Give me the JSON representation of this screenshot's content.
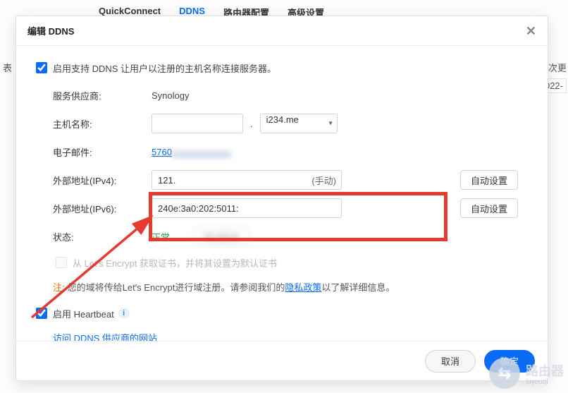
{
  "background": {
    "tabs": [
      "QuickConnect",
      "DDNS",
      "路由器配置",
      "高级设置"
    ],
    "active_tab_index": 1,
    "left_snip": "表",
    "right_snip_top": "次更",
    "right_snip_year": "022-"
  },
  "modal": {
    "title": "编辑 DDNS",
    "close_glyph": "✕"
  },
  "form": {
    "enable_checkbox_label": "启用支持 DDNS 让用户以注册的主机名称连接服务器。",
    "enable_checked": true,
    "provider_label": "服务供应商:",
    "provider_value": "Synology",
    "hostname_label": "主机名称:",
    "hostname_value": "",
    "hostname_domain": "i234.me",
    "email_label": "电子邮件:",
    "email_value": "5760",
    "ipv4_label": "外部地址(IPv4):",
    "ipv4_value": "121.",
    "ipv4_suffix": "(手动)",
    "ipv4_auto_btn": "自动设置",
    "ipv6_label": "外部地址(IPv6):",
    "ipv6_value": "240e:3a0:202:5011:",
    "ipv6_auto_btn": "自动设置",
    "status_label": "状态:",
    "status_value": "正常",
    "status_test_btn": "测试联机",
    "lets_encrypt_checkbox_label": "从 Let's Encrypt 获取证书，并将其设置为默认证书",
    "lets_encrypt_checked": false,
    "helper_note_prefix": "注:",
    "helper_text_a": "您的域将传给Let's Encrypt进行域注册。请参阅我们的",
    "helper_link": "隐私政策",
    "helper_text_b": "以了解详细信息。",
    "heartbeat_label": "启用 Heartbeat",
    "heartbeat_checked": true,
    "vendor_link": "访问 DDNS 供应商的网站"
  },
  "footer": {
    "cancel": "取消",
    "ok": "确定"
  },
  "watermark": {
    "icon_glyph": "⇆",
    "text": "路由器",
    "sub": "luyouqi"
  }
}
